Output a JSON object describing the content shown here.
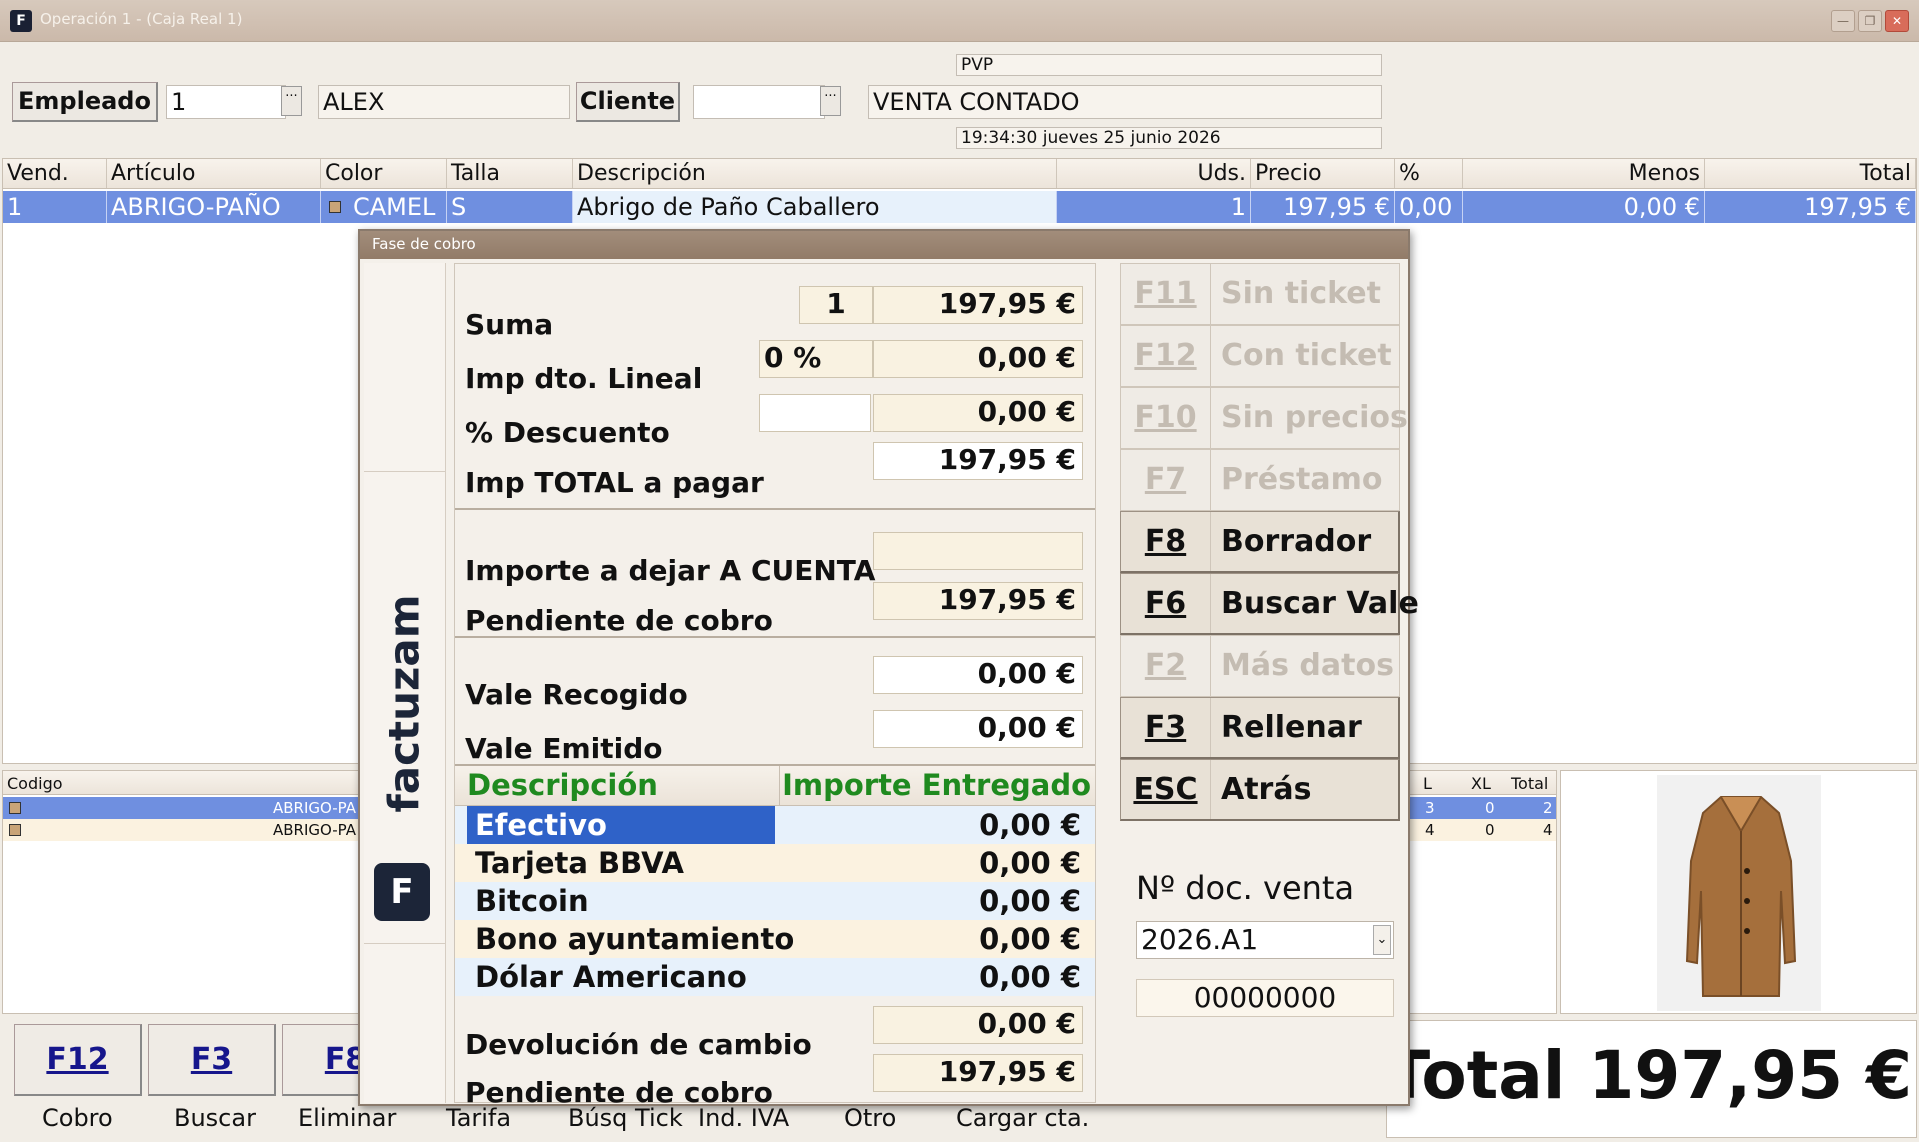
{
  "window": {
    "title": "Operación 1 - (Caja Real 1)",
    "app_icon": "F"
  },
  "header": {
    "empleado_btn": "Empleado",
    "empleado_code": "1",
    "empleado_name": "ALEX",
    "cliente_btn": "Cliente",
    "cliente_code": "",
    "tarifa": "PVP",
    "cliente_name": "VENTA CONTADO",
    "datetime": "19:34:30 jueves 25 junio 2026",
    "dots": "···"
  },
  "grid": {
    "headers": {
      "vend": "Vend.",
      "articulo": "Artículo",
      "color": "Color",
      "talla": "Talla",
      "descripcion": "Descripción",
      "uds": "Uds.",
      "precio": "Precio",
      "pct": "%",
      "menos": "Menos",
      "total": "Total"
    },
    "row": {
      "vend": "1",
      "articulo": "ABRIGO-PAÑO",
      "color": "CAMEL",
      "talla": "S",
      "descripcion": "Abrigo de Paño Caballero",
      "uds": "1",
      "precio": "197,95 €",
      "pct": "0,00",
      "menos": "0,00 €",
      "total": "197,95 €"
    }
  },
  "stock": {
    "code_header": "Codigo",
    "rows": [
      {
        "code": "ABRIGO-PA"
      },
      {
        "code": "ABRIGO-PA"
      }
    ],
    "size_headers": {
      "l": "L",
      "xl": "XL",
      "total": "Total"
    },
    "size_rows": [
      {
        "l": "3",
        "xl": "0",
        "total": "2"
      },
      {
        "l": "4",
        "xl": "0",
        "total": "4"
      }
    ]
  },
  "modal": {
    "title": "Fase de cobro",
    "brand": "factuzam",
    "brand_logo": "F",
    "suma_label": "Suma",
    "suma_qty": "1",
    "suma_value": "197,95 €",
    "dto_label": "Imp dto. Lineal",
    "dto_pct": "0 %",
    "dto_value": "0,00 €",
    "desc_label": "% Descuento",
    "desc_value": "0,00 €",
    "total_label": "Imp TOTAL a pagar",
    "total_value": "197,95 €",
    "cuenta_label": "Importe a dejar A CUENTA",
    "cuenta_value": "",
    "pendiente_label": "Pendiente de cobro",
    "pendiente_value": "197,95 €",
    "vale_recogido_label": "Vale Recogido",
    "vale_recogido_value": "0,00 €",
    "vale_emitido_label": "Vale Emitido",
    "vale_emitido_value": "0,00 €",
    "pay_header_desc": "Descripción",
    "pay_header_amount": "Importe Entregado",
    "payments": [
      {
        "desc": "Efectivo",
        "amount": "0,00 €"
      },
      {
        "desc": "Tarjeta BBVA",
        "amount": "0,00 €"
      },
      {
        "desc": "Bitcoin",
        "amount": "0,00 €"
      },
      {
        "desc": "Bono ayuntamiento",
        "amount": "0,00 €"
      },
      {
        "desc": "Dólar Americano",
        "amount": "0,00 €"
      }
    ],
    "devolucion_label": "Devolución de cambio",
    "devolucion_value": "0,00 €",
    "pendiente2_label": "Pendiente de cobro",
    "pendiente2_value": "197,95 €",
    "fkeys": [
      {
        "key": "F11",
        "label": "Sin ticket",
        "enabled": false
      },
      {
        "key": "F12",
        "label": "Con ticket",
        "enabled": false
      },
      {
        "key": "F10",
        "label": "Sin precios",
        "enabled": false
      },
      {
        "key": "F7",
        "label": "Préstamo",
        "enabled": false
      },
      {
        "key": "F8",
        "label": "Borrador",
        "enabled": true
      },
      {
        "key": "F6",
        "label": "Buscar Vale",
        "enabled": true
      },
      {
        "key": "F2",
        "label": "Más datos",
        "enabled": false
      },
      {
        "key": "F3",
        "label": "Rellenar",
        "enabled": true
      },
      {
        "key": "ESC",
        "label": "Atrás",
        "enabled": true
      }
    ],
    "doc_label": "Nº doc. venta",
    "doc_series": "2026.A1",
    "doc_number": "00000000"
  },
  "bottom": {
    "buttons": [
      {
        "key": "F12"
      },
      {
        "key": "F3"
      },
      {
        "key": "F8"
      }
    ],
    "labels": [
      "Cobro",
      "Buscar",
      "Eliminar",
      "Tarifa",
      "Búsq Tick",
      "Ind. IVA",
      "Otro",
      "Cargar cta."
    ],
    "total": "Total 197,95 €"
  },
  "colors": {
    "selection": "#6f8fe0",
    "accent_green": "#1f8a1f",
    "payment_selected": "#2f62c8"
  }
}
